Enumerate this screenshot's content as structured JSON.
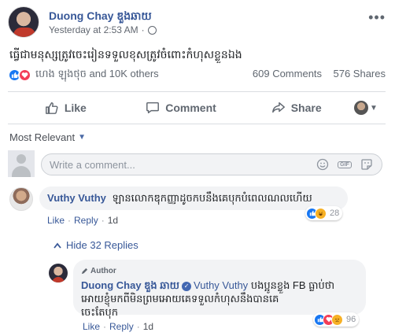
{
  "post": {
    "author": "Duong Chay ឌួង឵ឆាយ",
    "time": "Yesterday at 2:53 AM",
    "separator": "·",
    "text": "ធ្វើជាមនុស្សត្រូវចេះរៀនទទួលខុសត្រូវចំពោះកំហុសខ្លួនឯង",
    "reactions_text": "ហេង ឡុងថុច and 10K others",
    "comments_count": "609 Comments",
    "shares_count": "576 Shares"
  },
  "actions": {
    "like": "Like",
    "comment": "Comment",
    "share": "Share"
  },
  "comments_section": {
    "sort_label": "Most Relevant",
    "input_placeholder": "Write a comment...",
    "input_value": "",
    "gif_label": "GIF"
  },
  "comment1": {
    "author": "Vuthy Vuthy",
    "text": "ឡានលោកឌុកញ្ញាដូចកបនឹងគេបុកបំពេលណលហើយ",
    "like": "Like",
    "reply": "Reply",
    "time": "1d",
    "reactions_count": "28"
  },
  "hide_replies": "Hide 32 Replies",
  "reply1": {
    "badge": "Author",
    "author": "Duong Chay ឌួង ឆាយ",
    "mention": "Vuthy Vuthy",
    "text_line1": "បងប្អូនខ្លួង FB ធ្លាប់ថា",
    "text_line2": "អោយខ្ញុំមកពីមិនព្រមអោយគេទទួលកំហុសនឹងបានគេ",
    "text_line3": "ចេះតែបុក",
    "like": "Like",
    "reply": "Reply",
    "time": "1d",
    "reactions_count": "96"
  },
  "colors": {
    "link": "#385898",
    "like_blue": "#1877f2",
    "love_red": "#f33e58",
    "haha_yellow": "#f7b125"
  }
}
